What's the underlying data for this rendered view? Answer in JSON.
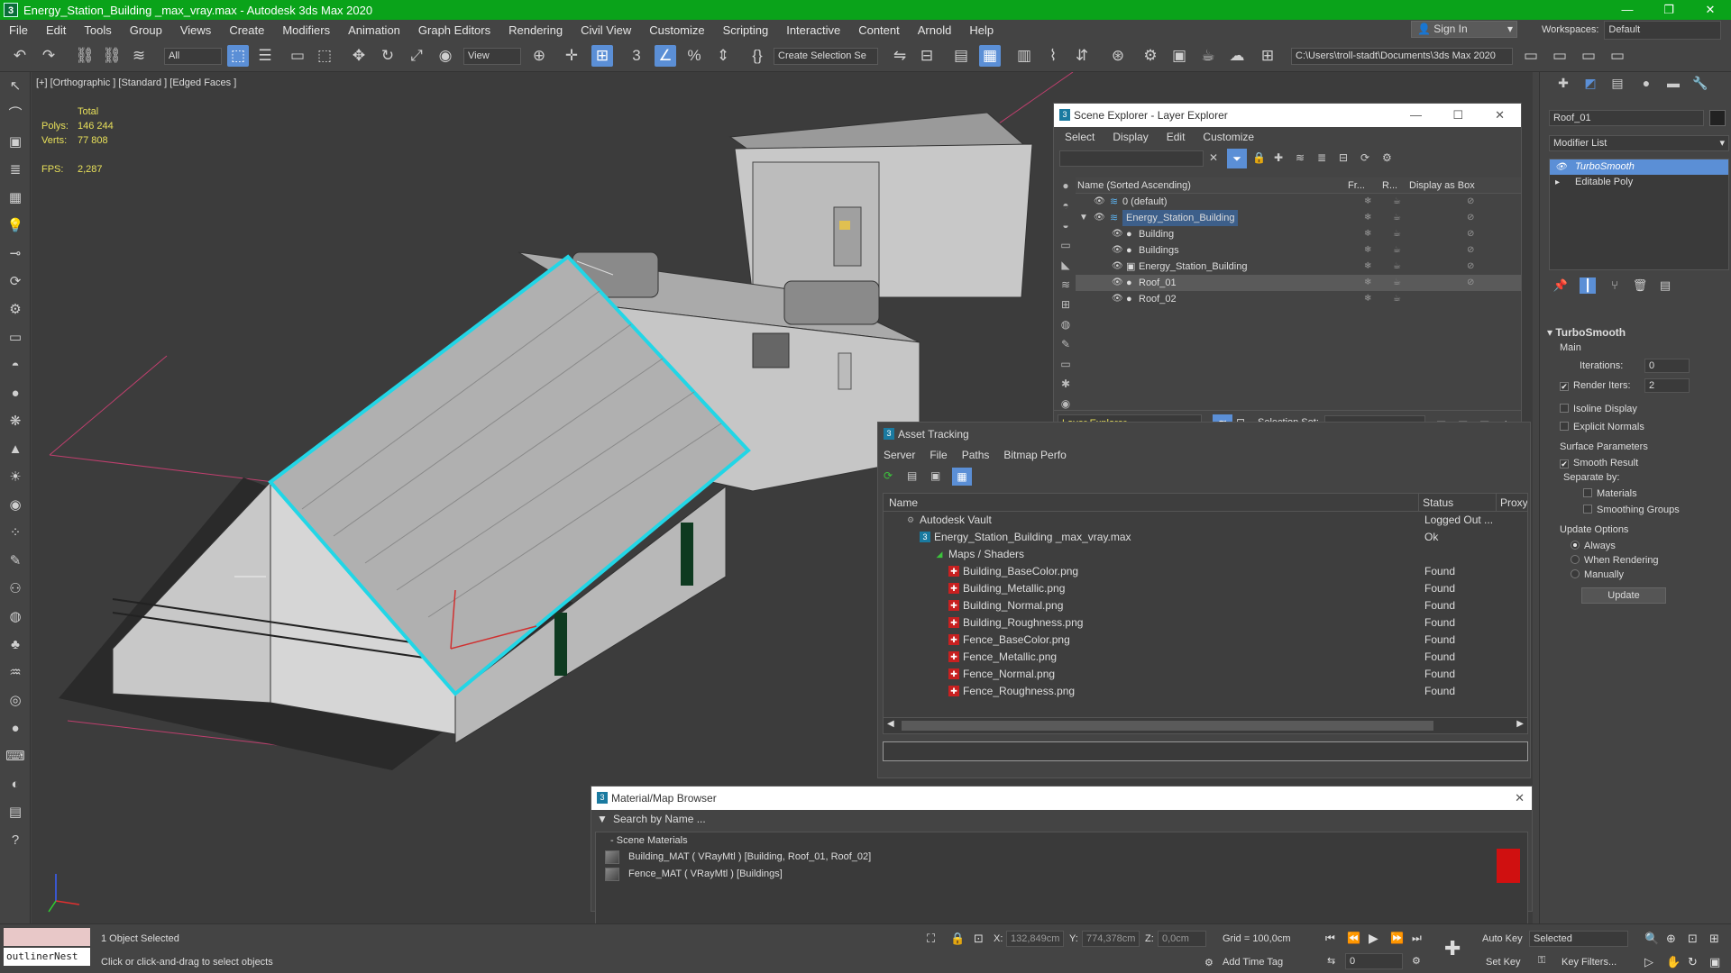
{
  "titlebar": {
    "title": "Energy_Station_Building _max_vray.max - Autodesk 3ds Max 2020",
    "app_icon": "3",
    "minimize": "—",
    "maximize": "❐",
    "close": "✕"
  },
  "menubar": {
    "items": [
      "File",
      "Edit",
      "Tools",
      "Group",
      "Views",
      "Create",
      "Modifiers",
      "Animation",
      "Graph Editors",
      "Rendering",
      "Civil View",
      "Customize",
      "Scripting",
      "Interactive",
      "Content",
      "Arnold",
      "Help"
    ]
  },
  "signin": {
    "label": "Sign In"
  },
  "workspaces": {
    "label": "Workspaces:",
    "value": "Default"
  },
  "toolbar": {
    "filter_value": "All",
    "ref_coord": "View",
    "selection_set": "Create Selection Se",
    "project_path": "C:\\Users\\troll-stadt\\Documents\\3ds Max 2020"
  },
  "viewport": {
    "label": "[+] [Orthographic ] [Standard ] [Edged Faces ]",
    "stats": {
      "total_label": "Total",
      "polys_label": "Polys:",
      "polys": "146 244",
      "verts_label": "Verts:",
      "verts": "77 808",
      "fps_label": "FPS:",
      "fps": "2,287"
    }
  },
  "scene_explorer": {
    "title": "Scene Explorer - Layer Explorer",
    "menu": [
      "Select",
      "Display",
      "Edit",
      "Customize"
    ],
    "columns": [
      "Name (Sorted Ascending)",
      "Fr...",
      "R...",
      "Display as Box"
    ],
    "rows": [
      {
        "name": "0 (default)",
        "indent": 0
      },
      {
        "name": "Energy_Station_Building",
        "indent": 0
      },
      {
        "name": "Building",
        "indent": 1
      },
      {
        "name": "Buildings",
        "indent": 1
      },
      {
        "name": "Energy_Station_Building",
        "indent": 1
      },
      {
        "name": "Roof_01",
        "indent": 1
      },
      {
        "name": "Roof_02",
        "indent": 1
      }
    ],
    "bottom_dropdown": "Layer Explorer",
    "selection_set_label": "Selection Set:"
  },
  "asset_tracking": {
    "title": "Asset Tracking",
    "menu": [
      "Server",
      "File",
      "Paths",
      "Bitmap Perfo"
    ],
    "columns": [
      "Name",
      "Status",
      "Proxy"
    ],
    "rows": [
      {
        "name": "Autodesk Vault",
        "status": "Logged Out ...",
        "indent": 1
      },
      {
        "name": "Energy_Station_Building _max_vray.max",
        "status": "Ok",
        "indent": 2
      },
      {
        "name": "Maps / Shaders",
        "status": "",
        "indent": 3
      },
      {
        "name": "Building_BaseColor.png",
        "status": "Found",
        "indent": 4
      },
      {
        "name": "Building_Metallic.png",
        "status": "Found",
        "indent": 4
      },
      {
        "name": "Building_Normal.png",
        "status": "Found",
        "indent": 4
      },
      {
        "name": "Building_Roughness.png",
        "status": "Found",
        "indent": 4
      },
      {
        "name": "Fence_BaseColor.png",
        "status": "Found",
        "indent": 4
      },
      {
        "name": "Fence_Metallic.png",
        "status": "Found",
        "indent": 4
      },
      {
        "name": "Fence_Normal.png",
        "status": "Found",
        "indent": 4
      },
      {
        "name": "Fence_Roughness.png",
        "status": "Found",
        "indent": 4
      }
    ]
  },
  "material_browser": {
    "title": "Material/Map Browser",
    "search_placeholder": "Search by Name ...",
    "group": "Scene Materials",
    "materials": [
      "Building_MAT ( VRayMtl ) [Building, Roof_01, Roof_02]",
      "Fence_MAT ( VRayMtl ) [Buildings]"
    ]
  },
  "command_panel": {
    "object_name": "Roof_01",
    "modifier_list": "Modifier List",
    "stack": [
      "TurboSmooth",
      "Editable Poly"
    ],
    "rollout_title": "TurboSmooth",
    "main_label": "Main",
    "iterations_label": "Iterations:",
    "iterations": "0",
    "render_iters_label": "Render Iters:",
    "render_iters": "2",
    "isoline": "Isoline Display",
    "explicit_normals": "Explicit Normals",
    "surface_params": "Surface Parameters",
    "smooth_result": "Smooth Result",
    "separate_by": "Separate by:",
    "materials": "Materials",
    "smoothing_groups": "Smoothing Groups",
    "update_options": "Update Options",
    "always": "Always",
    "when_rendering": "When Rendering",
    "manually": "Manually",
    "update_button": "Update"
  },
  "statusbar": {
    "script_field": "outlinerNest",
    "selection": "1 Object Selected",
    "prompt": "Click or click-and-drag to select objects",
    "x_label": "X:",
    "x": "132,849cm",
    "y_label": "Y:",
    "y": "774,378cm",
    "z_label": "Z:",
    "z": "0,0cm",
    "grid": "Grid = 100,0cm",
    "add_time_tag": "Add Time Tag",
    "auto_key": "Auto Key",
    "set_key": "Set Key",
    "selected": "Selected",
    "key_filters": "Key Filters...",
    "frame": "0"
  }
}
